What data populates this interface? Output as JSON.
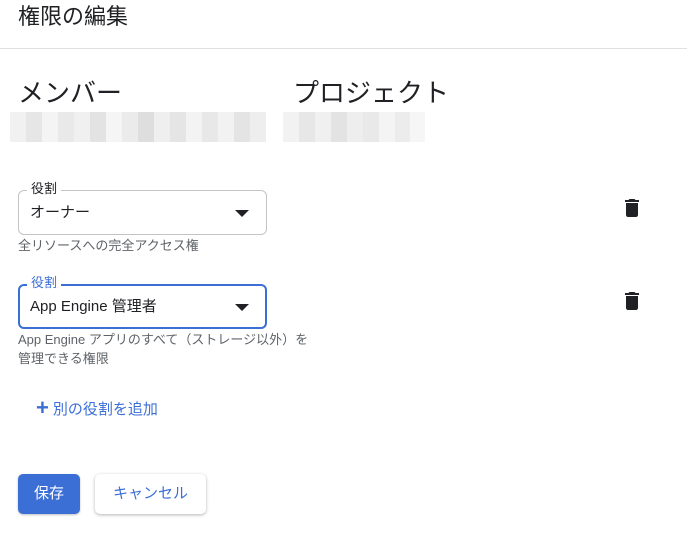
{
  "header": {
    "title": "権限の編集"
  },
  "columns": {
    "member": "メンバー",
    "project": "プロジェクト"
  },
  "roles": [
    {
      "label": "役割",
      "value": "オーナー",
      "description": "全リソースへの完全アクセス権",
      "icon": "trash-icon"
    },
    {
      "label": "役割",
      "value": "App Engine 管理者",
      "description": "App Engine アプリのすべて（ストレージ以外）を管理できる権限",
      "icon": "trash-icon"
    }
  ],
  "add_role": {
    "icon": "plus-icon",
    "label": "別の役割を追加"
  },
  "actions": {
    "save": "保存",
    "cancel": "キャンセル"
  },
  "colors": {
    "accent": "#3c6fd6",
    "text": "#202124",
    "secondary_text": "#5f6368",
    "border": "#c4c4c4",
    "divider": "#e0e0e0"
  }
}
